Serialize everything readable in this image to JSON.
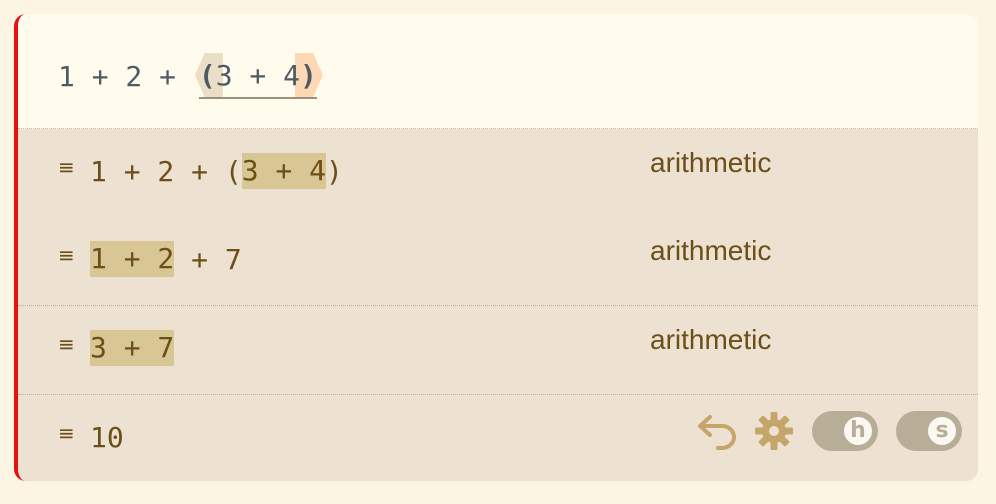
{
  "editor": {
    "prefix": "1 + 2 + ",
    "open_paren": "(",
    "inner": "3 + 4",
    "close_paren": ")"
  },
  "steps": [
    {
      "handle": "≡",
      "pre": "1 + 2 + (",
      "hl": "3 + 4",
      "post": ")",
      "rule": "arithmetic"
    },
    {
      "handle": "≡",
      "pre": "",
      "hl": "1 + 2",
      "post": " + 7",
      "rule": "arithmetic"
    },
    {
      "handle": "≡",
      "pre": "",
      "hl": "3 + 7",
      "post": "",
      "rule": "arithmetic"
    }
  ],
  "result": {
    "handle": "≡",
    "value": "10"
  },
  "controls": {
    "undo_icon": "undo-icon",
    "settings_icon": "gear-icon",
    "toggle_h": "h",
    "toggle_s": "s"
  },
  "colors": {
    "accent_border": "#e81010",
    "highlight": "#d8c694",
    "step_text": "#6b4f17",
    "control_tan": "#c4a56a"
  }
}
